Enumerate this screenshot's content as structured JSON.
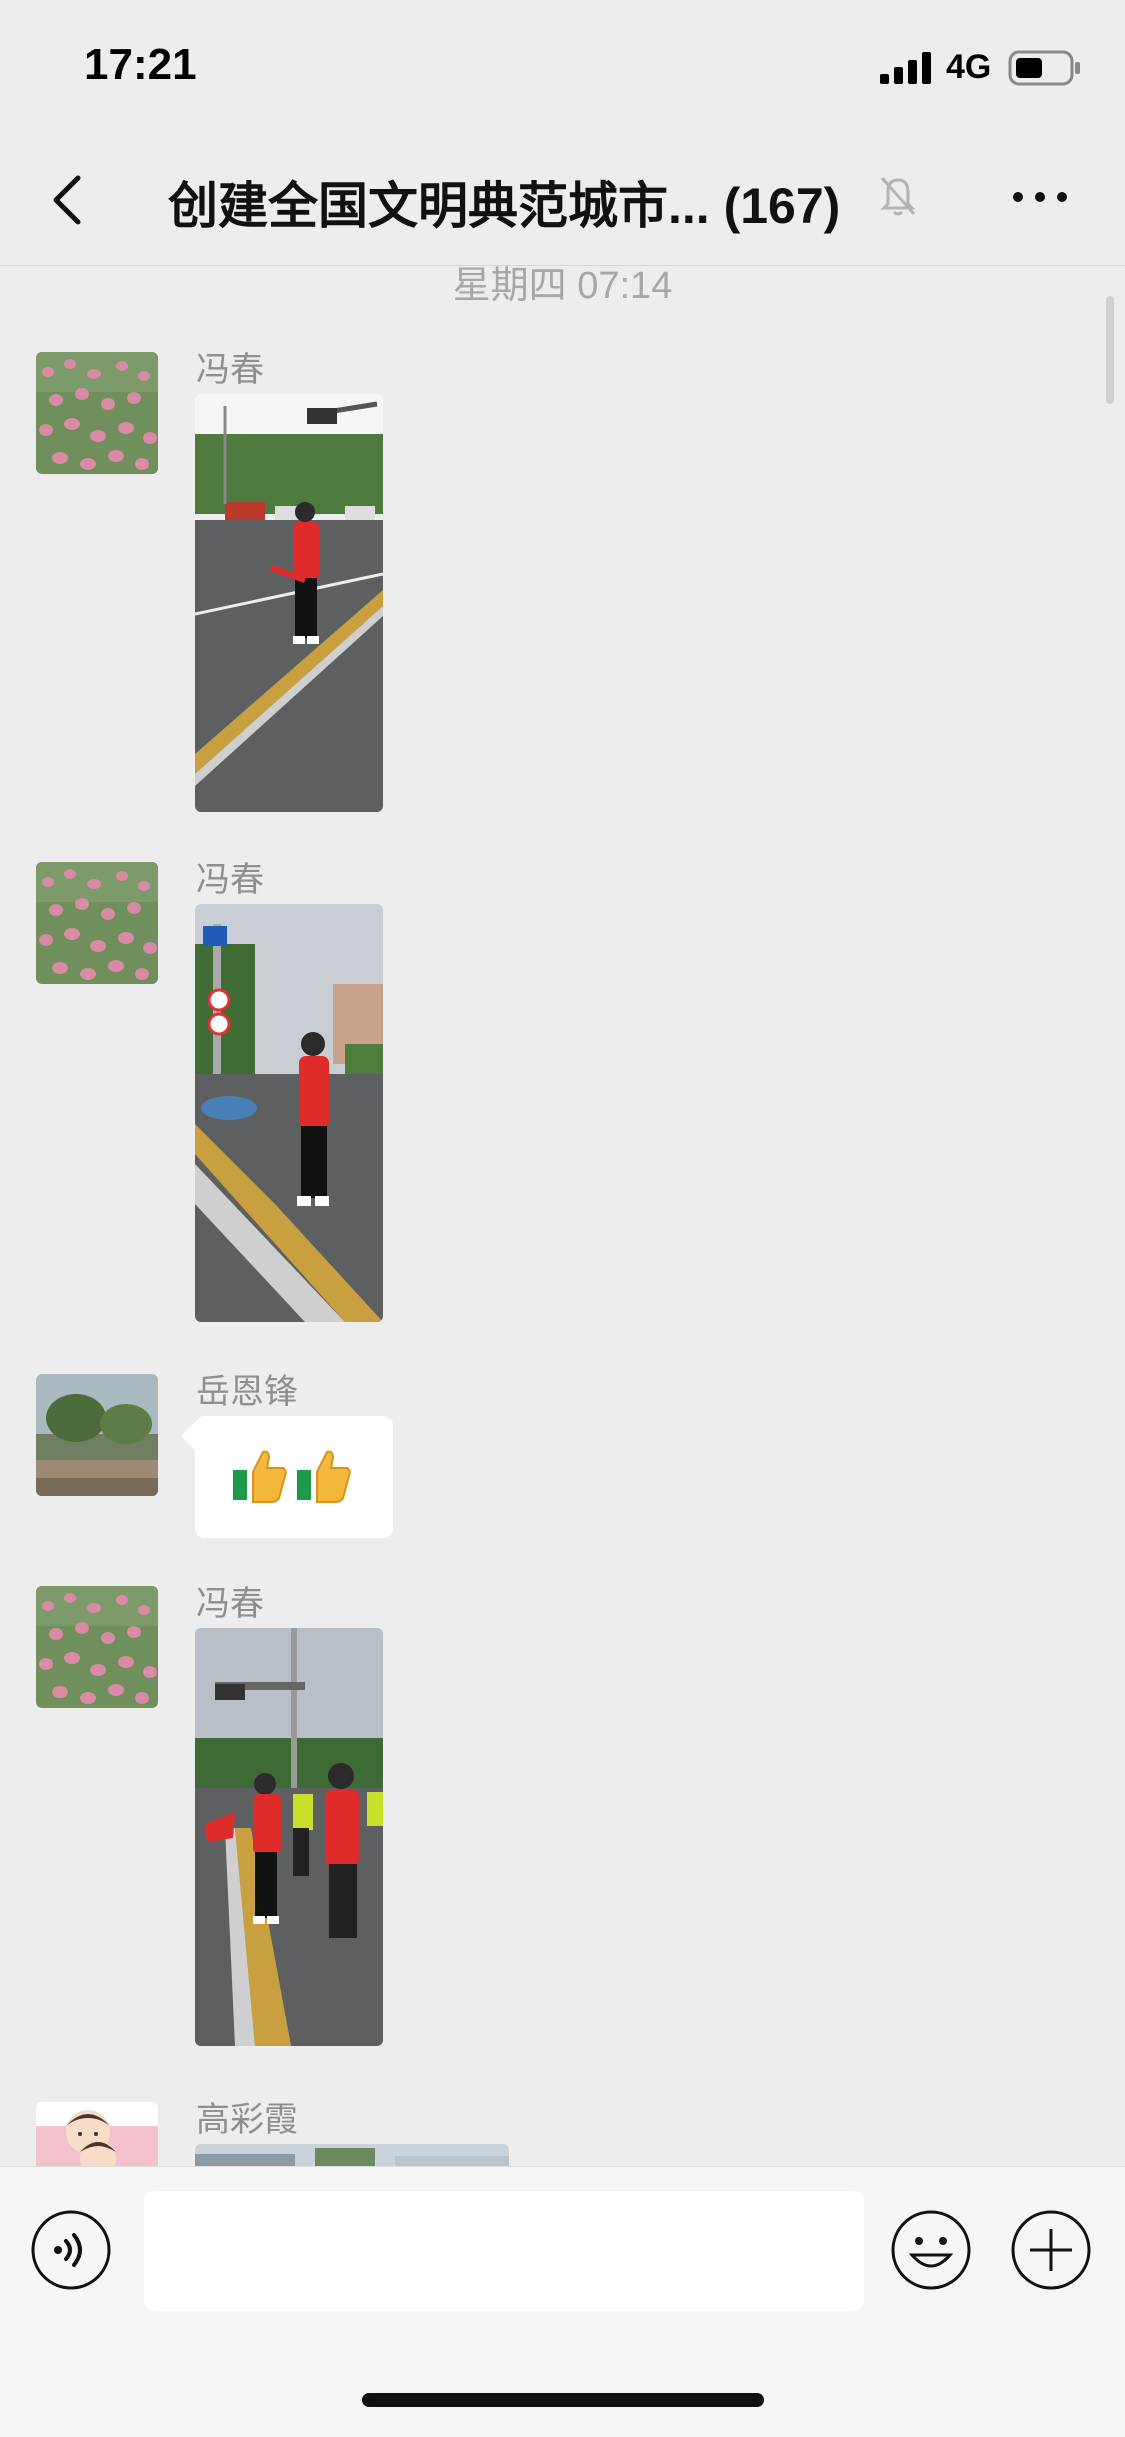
{
  "status": {
    "time": "17:21",
    "network": "4G"
  },
  "nav": {
    "title": "创建全国文明典范城市... (167)"
  },
  "chat": {
    "timestamp": "星期四 07:14",
    "messages": [
      {
        "sender": "冯春",
        "type": "image"
      },
      {
        "sender": "冯春",
        "type": "image"
      },
      {
        "sender": "岳恩锋",
        "type": "emoji",
        "content": "thumbs-up x2"
      },
      {
        "sender": "冯春",
        "type": "image"
      },
      {
        "sender": "高彩霞",
        "type": "image"
      }
    ]
  },
  "input": {
    "placeholder": ""
  },
  "colors": {
    "background": "#ededed",
    "vest": "#e02b2b",
    "bubble": "#ffffff"
  },
  "icons": [
    "back-chevron-icon",
    "mute-bell-icon",
    "more-dots-icon",
    "voice-icon",
    "emoji-icon",
    "plus-icon",
    "signal-icon",
    "battery-icon"
  ]
}
